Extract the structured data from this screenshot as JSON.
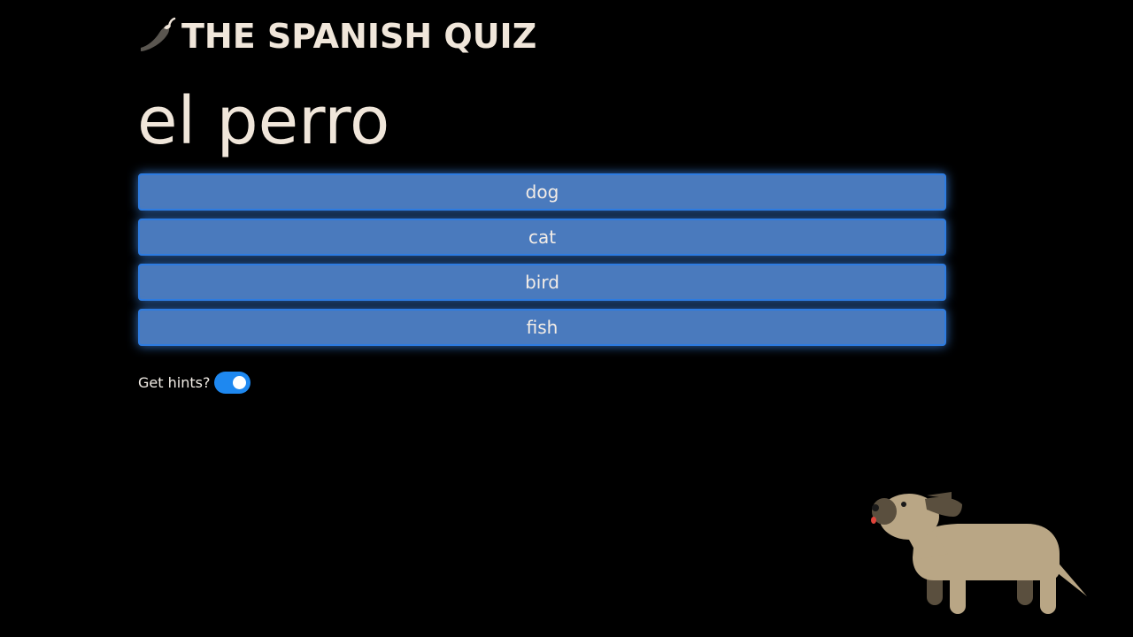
{
  "header": {
    "logo_icon": "chili-pepper-icon",
    "title": "THE SPANISH QUIZ"
  },
  "question": {
    "word": "el perro"
  },
  "answers": [
    {
      "label": "dog"
    },
    {
      "label": "cat"
    },
    {
      "label": "bird"
    },
    {
      "label": "fish"
    }
  ],
  "hints": {
    "label": "Get hints?",
    "enabled": true
  },
  "illustration": {
    "icon": "dog-illustration"
  },
  "colors": {
    "background": "#000000",
    "text": "#f0e6da",
    "button": "#4a7abd",
    "button_glow": "#4696ff",
    "toggle_on": "#1e88f0"
  }
}
